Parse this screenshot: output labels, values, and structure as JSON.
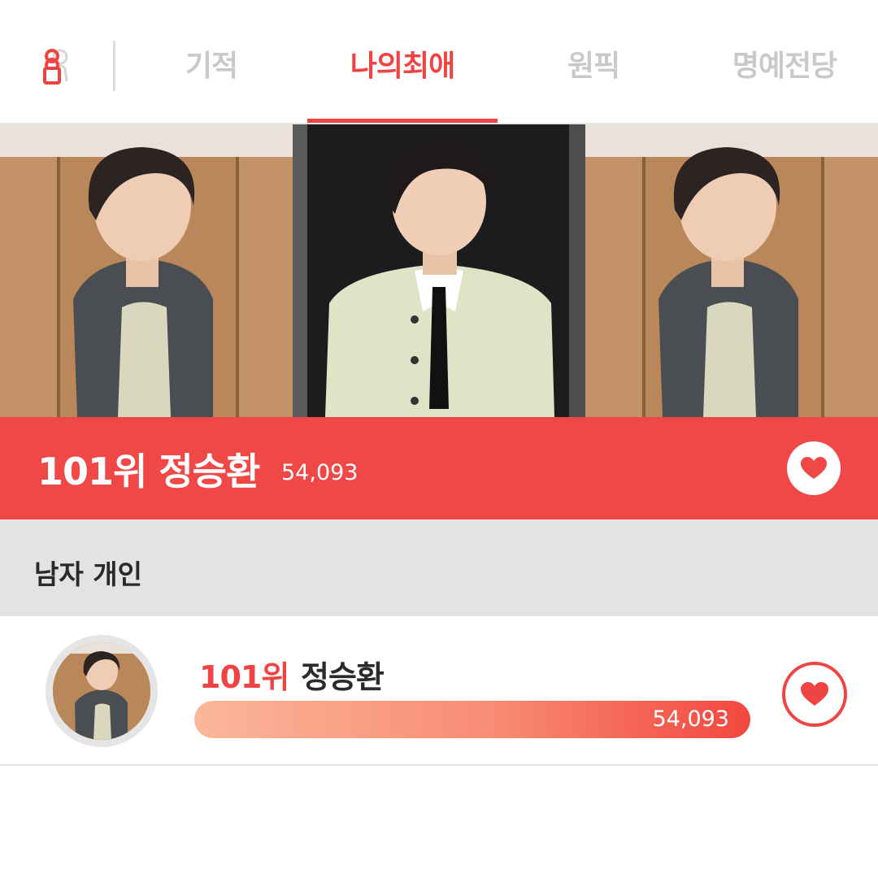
{
  "nav": {
    "logo_icon": "person-pin-icon",
    "tabs": [
      {
        "label": "기적",
        "active": false
      },
      {
        "label": "나의최애",
        "active": true
      },
      {
        "label": "원픽",
        "active": false
      },
      {
        "label": "명예전당",
        "active": false
      }
    ]
  },
  "colors": {
    "accent": "#ef4444",
    "rank_bar": "#f04747",
    "category_bg": "#e3e3e3",
    "tab_inactive": "#c9c9c9"
  },
  "banner": {
    "photos": [
      "artist-photo-leather-jacket",
      "artist-photo-knit-cardigan",
      "artist-photo-leather-jacket"
    ]
  },
  "featured": {
    "rank": "101위",
    "name": "정승환",
    "title": "101위 정승환",
    "votes": "54,093",
    "action_icon": "heart-icon"
  },
  "category": {
    "label": "남자 개인"
  },
  "list": [
    {
      "rank": "101위",
      "name": "정승환",
      "votes": "54,093",
      "progress": 1.0,
      "action_icon": "heart-icon"
    }
  ]
}
